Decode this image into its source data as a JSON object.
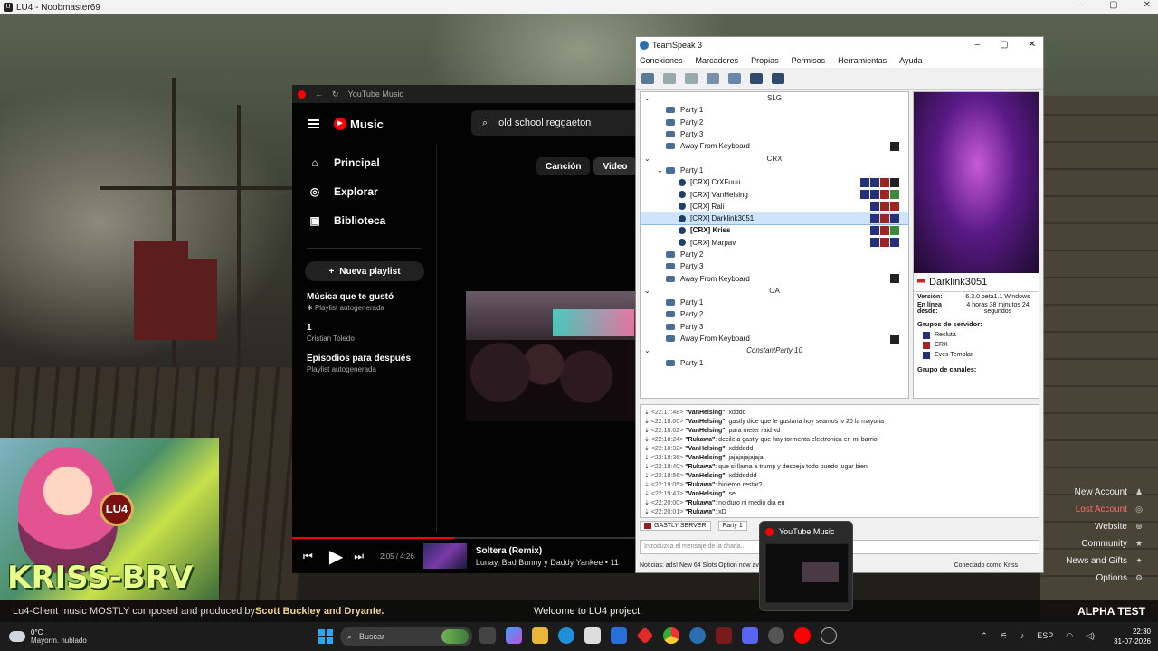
{
  "window_title": "LU4 - Noobmaster69",
  "game_logo_letter": "U",
  "stream": {
    "badge": "LU4",
    "streamer_name": "KRISS-BRV"
  },
  "info_bar": {
    "credits_text": "Lu4-Client music MOSTLY composed and produced by ",
    "credits_names": "Scott Buckley and Dryante.",
    "welcome": "Welcome to LU4 project.",
    "alpha": "ALPHA TEST"
  },
  "side_links": [
    {
      "label": "New Account",
      "icon": "person-add-icon"
    },
    {
      "label": "Lost Account",
      "icon": "circle-icon"
    },
    {
      "label": "Website",
      "icon": "globe-icon"
    },
    {
      "label": "Community",
      "icon": "star-icon"
    },
    {
      "label": "News and Gifts",
      "icon": "gift-icon"
    },
    {
      "label": "Options",
      "icon": "gear-icon"
    }
  ],
  "youtube_music": {
    "window_title": "YouTube Music",
    "logo": "Music",
    "search_value": "old school reggaeton",
    "nav": [
      {
        "label": "Principal",
        "icon": "home-icon"
      },
      {
        "label": "Explorar",
        "icon": "compass-icon"
      },
      {
        "label": "Biblioteca",
        "icon": "library-icon"
      }
    ],
    "new_playlist": "Nueva playlist",
    "playlists": [
      {
        "title": "Música que te gustó",
        "subtitle": "Playlist autogenerada",
        "pinned": true
      },
      {
        "title": "1",
        "subtitle": "Cristian Toledo",
        "pinned": false
      },
      {
        "title": "Episodios para después",
        "subtitle": "Playlist autogenerada",
        "pinned": false
      }
    ],
    "chips": [
      "Canción",
      "Video"
    ],
    "active_chip": "Video",
    "player": {
      "time": "2:05 / 4:26",
      "progress": 0.47,
      "song": "Soltera (Remix)",
      "artists": "Lunay, Bad Bunny y Daddy Yankee • 11"
    }
  },
  "teamspeak": {
    "window_title": "TeamSpeak 3",
    "menu": [
      "Conexiones",
      "Marcadores",
      "Propias",
      "Permisos",
      "Herramientas",
      "Ayuda"
    ],
    "tree": [
      {
        "type": "spacer",
        "label": "SLG"
      },
      {
        "type": "channel",
        "label": "Party 1"
      },
      {
        "type": "channel",
        "label": "Party 2"
      },
      {
        "type": "channel",
        "label": "Party 3"
      },
      {
        "type": "channel",
        "label": "Away From Keyboard",
        "tags": [
          "afk"
        ]
      },
      {
        "type": "spacer",
        "label": "CRX"
      },
      {
        "type": "channel-open",
        "label": "Party 1"
      },
      {
        "type": "user",
        "label": "[CRX] CrXFuuu",
        "tags": [
          "b",
          "b",
          "r",
          "k"
        ]
      },
      {
        "type": "user",
        "label": "[CRX] VanHelsing",
        "tags": [
          "b",
          "b",
          "r",
          "g"
        ]
      },
      {
        "type": "user",
        "label": "[CRX] Rali",
        "tags": [
          "b",
          "r",
          "r"
        ]
      },
      {
        "type": "user",
        "label": "[CRX] Darklink3051",
        "selected": true,
        "tags": [
          "b",
          "r",
          "b"
        ]
      },
      {
        "type": "user",
        "label": "[CRX] Kriss",
        "bold": true,
        "tags": [
          "b",
          "r",
          "g"
        ]
      },
      {
        "type": "user",
        "label": "[CRX] Marpav",
        "tags": [
          "b",
          "r",
          "b"
        ]
      },
      {
        "type": "channel",
        "label": "Party 2"
      },
      {
        "type": "channel",
        "label": "Party 3"
      },
      {
        "type": "channel",
        "label": "Away From Keyboard",
        "tags": [
          "afk"
        ]
      },
      {
        "type": "spacer",
        "label": "OA"
      },
      {
        "type": "channel",
        "label": "Party 1"
      },
      {
        "type": "channel",
        "label": "Party 2"
      },
      {
        "type": "channel",
        "label": "Party 3"
      },
      {
        "type": "channel",
        "label": "Away From Keyboard",
        "tags": [
          "afk"
        ]
      },
      {
        "type": "spacer",
        "label": "ConstantParty 10"
      },
      {
        "type": "channel",
        "label": "Party 1"
      }
    ],
    "info": {
      "nickname": "Darklink3051",
      "version_label": "Versión:",
      "version": "6.3.0 beta1.1 Windows",
      "online_label": "En línea desde:",
      "online": "4 horas 38 minutos 24 segundos",
      "server_groups_label": "Grupos de servidor:",
      "server_groups": [
        "Recluta",
        "CRX",
        "Eves Templar"
      ],
      "channel_group_label": "Grupo de canales:"
    },
    "chat": [
      {
        "time": "<22:17:48>",
        "user": "\"VanHelsing\"",
        "msg": ": xdddd"
      },
      {
        "time": "<22:18:00>",
        "user": "\"VanHelsing\"",
        "msg": ": gastly dice que le gustaria hoy seamos lv 20 la mayoria"
      },
      {
        "time": "<22:18:02>",
        "user": "\"VanHelsing\"",
        "msg": ": para meter raid xd"
      },
      {
        "time": "<22:18:24>",
        "user": "\"Rukawa\"",
        "msg": ": decile a gastly que hay tormenta electronica en mi barrio"
      },
      {
        "time": "<22:18:32>",
        "user": "\"VanHelsing\"",
        "msg": ": xdddddd"
      },
      {
        "time": "<22:18:36>",
        "user": "\"VanHelsing\"",
        "msg": ": jajajajajajaja"
      },
      {
        "time": "<22:18:40>",
        "user": "\"Rukawa\"",
        "msg": ": que si llama a trump y despeja todo puedo jugar bien"
      },
      {
        "time": "<22:18:56>",
        "user": "\"VanHelsing\"",
        "msg": ": xddddddd"
      },
      {
        "time": "<22:19:05>",
        "user": "\"Rukawa\"",
        "msg": ": hicieron restar?"
      },
      {
        "time": "<22:19:47>",
        "user": "\"VanHelsing\"",
        "msg": ": se"
      },
      {
        "time": "<22:20:00>",
        "user": "\"Rukawa\"",
        "msg": ": no duro ni medio dia en"
      },
      {
        "time": "<22:20:01>",
        "user": "\"Rukawa\"",
        "msg": ": xD"
      }
    ],
    "tabs": [
      "GASTLY SERVER",
      "Party 1"
    ],
    "input_placeholder": "Introduzca el mensaje de la charla...",
    "status_text": "Noticias: ads! New 64 Slots Option now av",
    "connection": "Conectado como Kriss"
  },
  "taskbar": {
    "weather_temp": "0°C",
    "weather_desc": "Mayorm. nublado",
    "search_placeholder": "Buscar",
    "lang": "ESP",
    "time": "22:30",
    "date": "31-07-2026",
    "preview_title": "YouTube Music"
  }
}
